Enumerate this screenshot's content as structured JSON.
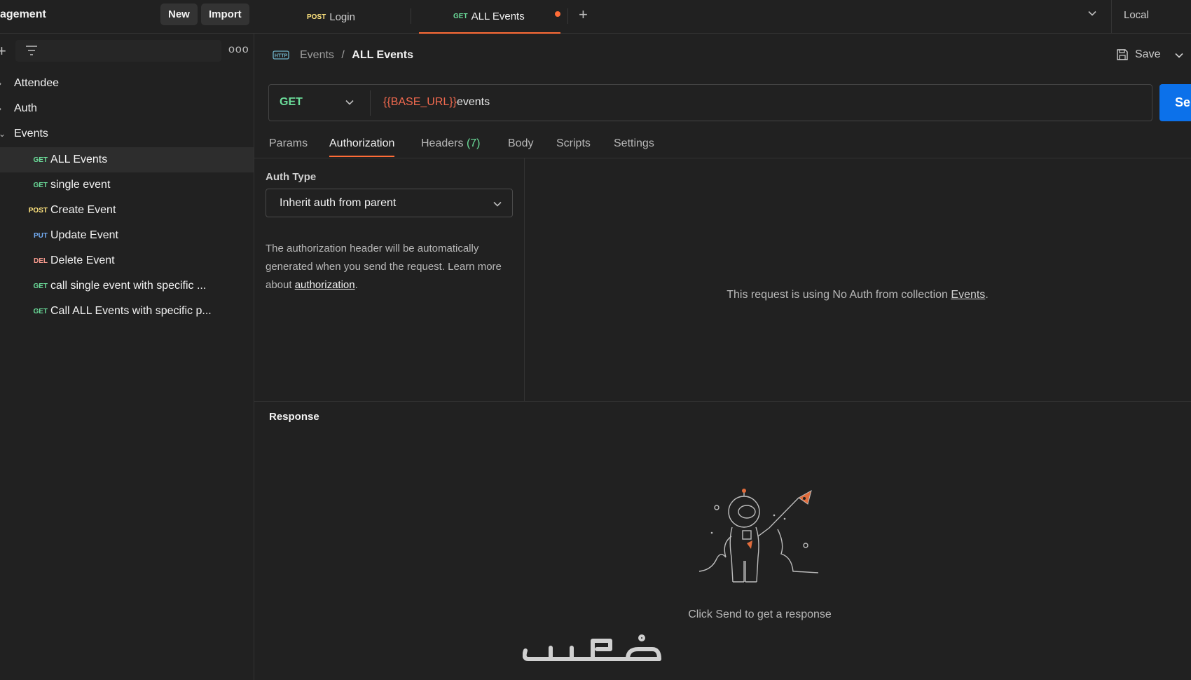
{
  "topbar": {
    "workspace_title": "agement",
    "new_label": "New",
    "import_label": "Import",
    "tabs": [
      {
        "method": "POST",
        "label": "Login"
      },
      {
        "method": "GET",
        "label": "ALL Events"
      }
    ],
    "environment": "Local"
  },
  "sidebar": {
    "folders": [
      "Attendee",
      "Auth",
      "Events"
    ],
    "requests": [
      {
        "method": "GET",
        "label": "ALL Events"
      },
      {
        "method": "GET",
        "label": "single event"
      },
      {
        "method": "POST",
        "label": "Create Event"
      },
      {
        "method": "PUT",
        "label": "Update Event"
      },
      {
        "method": "DEL",
        "label": "Delete Event"
      },
      {
        "method": "GET",
        "label": "call single event with specific ..."
      },
      {
        "method": "GET",
        "label": "Call ALL Events with specific p..."
      }
    ]
  },
  "breadcrumb": {
    "parent": "Events",
    "separator": "/",
    "current": "ALL Events"
  },
  "save_label": "Save",
  "urlbar": {
    "method": "GET",
    "url_variable": "{{BASE_URL}}",
    "url_path": "events",
    "send_label": "Se"
  },
  "request_tabs": {
    "params": "Params",
    "authorization": "Authorization",
    "headers": "Headers",
    "headers_count": "(7)",
    "body": "Body",
    "scripts": "Scripts",
    "settings": "Settings"
  },
  "auth": {
    "type_label": "Auth Type",
    "selected": "Inherit auth from parent",
    "help_text": "The authorization header will be automatically generated when you send the request. Learn more about ",
    "help_link": "authorization",
    "help_end": ".",
    "noauth_text": "This request is using No Auth from collection ",
    "noauth_link": "Events",
    "noauth_end": "."
  },
  "response": {
    "title": "Response",
    "hint": "Click Send to get a response"
  },
  "watermark": "خمسات",
  "colors": {
    "accent": "#ff6c37",
    "send": "#0c71ea",
    "get": "#6bdd9a",
    "post": "#ffe47e",
    "put": "#74aef6",
    "del": "#f79a8e",
    "url_variable": "#f26a4f"
  }
}
